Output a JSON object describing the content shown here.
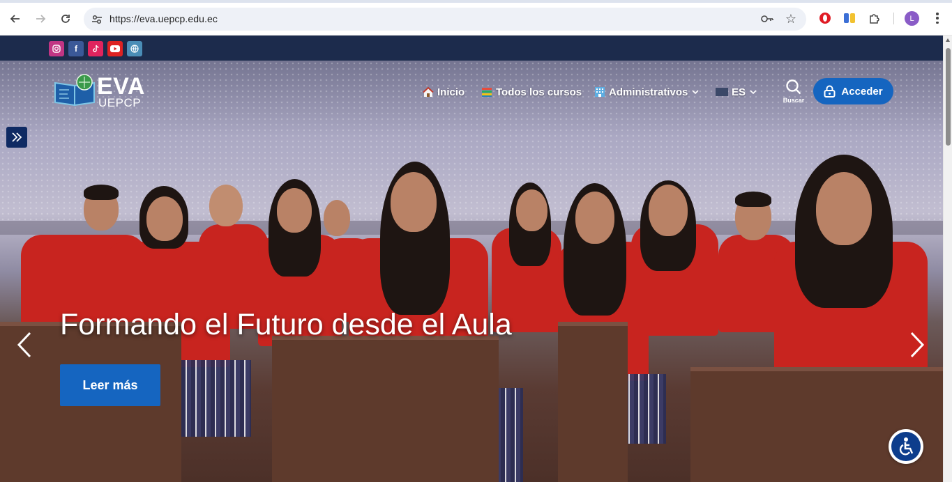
{
  "browser": {
    "url": "https://eva.uepcp.edu.ec",
    "profile_initial": "L"
  },
  "site": {
    "logo_title": "EVA",
    "logo_subtitle": "UEPCP",
    "social": [
      {
        "name": "instagram",
        "color": "#c13584"
      },
      {
        "name": "facebook",
        "color": "#3b5998"
      },
      {
        "name": "tiktok",
        "color": "#e0245e"
      },
      {
        "name": "youtube",
        "color": "#d22"
      },
      {
        "name": "website",
        "color": "#4a8db7"
      }
    ],
    "nav": {
      "inicio": "Inicio",
      "cursos": "Todos los cursos",
      "administrativos": "Administrativos",
      "language": "ES",
      "search_label": "Buscar",
      "login": "Acceder"
    }
  },
  "hero": {
    "headline": "Formando el Futuro desde el Aula",
    "cta": "Leer más"
  },
  "colors": {
    "topbar": "#1c2b4c",
    "accent": "#1565c0"
  }
}
